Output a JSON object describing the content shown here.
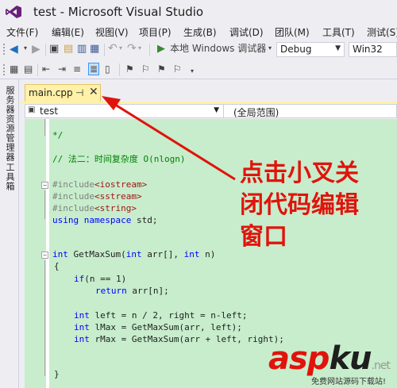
{
  "window": {
    "title": "test - Microsoft Visual Studio"
  },
  "menu": [
    "文件(F)",
    "编辑(E)",
    "视图(V)",
    "项目(P)",
    "生成(B)",
    "调试(D)",
    "团队(M)",
    "工具(T)",
    "测试(S)"
  ],
  "toolbar": {
    "debugger_label": "本地 Windows 调试器",
    "config": "Debug",
    "platform": "Win32"
  },
  "sidebar": {
    "server_explorer": "服务器资源管理器",
    "toolbox": "工具箱"
  },
  "tab": {
    "label": "main.cpp"
  },
  "navbar": {
    "scope": "test",
    "member": "(全局范围)"
  },
  "code": {
    "l_close_comment": "*/",
    "l_method_comment": "// 法二：时间复杂度 O(nlogn)",
    "inc1_kw": "#include",
    "inc1_file": "<iostream>",
    "inc2_kw": "#include",
    "inc2_file": "<sstream>",
    "inc3_kw": "#include",
    "inc3_file": "<string>",
    "using_kw1": "using",
    "using_kw2": "namespace",
    "using_rest": " std;",
    "fn_kw": "int",
    "fn_name": " GetMaxSum(",
    "fn_kw2": "int",
    "fn_arr": " arr[], ",
    "fn_kw3": "int",
    "fn_n": " n)",
    "brace_open": "{",
    "if_kw": "if",
    "if_rest": "(n == 1)",
    "ret_kw": "return",
    "ret_rest": " arr[n];",
    "left_kw": "int",
    "left_rest": " left = n / 2, right = n-left;",
    "lmax_kw": "int",
    "lmax_rest": " lMax = GetMaxSum(arr, left);",
    "rmax_kw": "int",
    "rmax_rest": " rMax = GetMaxSum(arr + left, right);",
    "brace_close": "}"
  },
  "annotation": {
    "line1": "点击小叉关",
    "line2": "闭代码编辑",
    "line3": "窗口"
  },
  "watermark": {
    "asp": "asp",
    "ku": "ku",
    "suffix": ".net",
    "sub": "免费网站源码下载站!"
  },
  "colors": {
    "annotation": "#e0140c",
    "editor_bg": "#c7edcc",
    "tab_active": "#fff1a8"
  }
}
